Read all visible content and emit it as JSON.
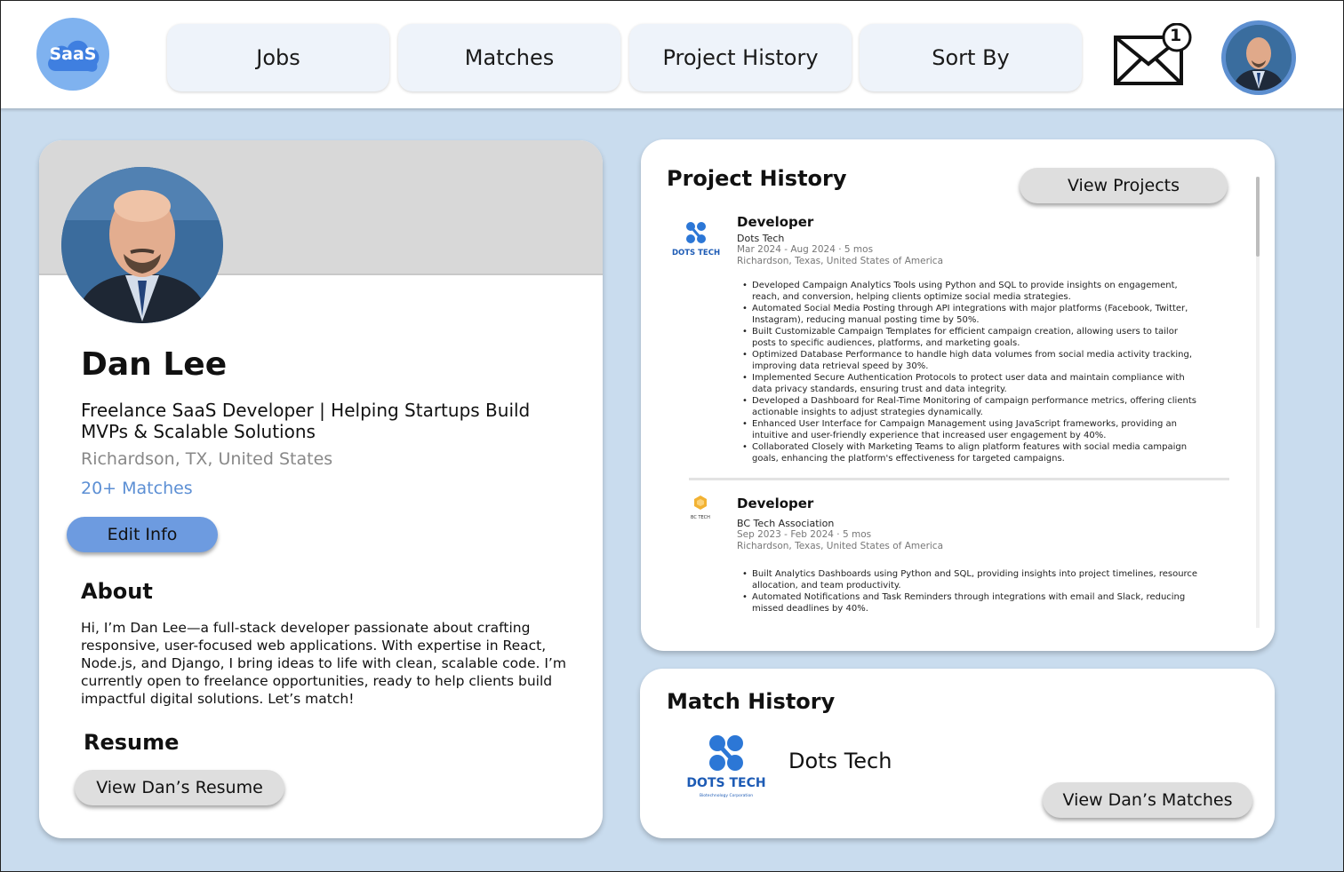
{
  "app": {
    "logo_text": "SaaS",
    "accent_color": "#6d9be0",
    "background_color": "#c9dcee"
  },
  "nav": {
    "items": [
      {
        "label": "Jobs"
      },
      {
        "label": "Matches"
      },
      {
        "label": "Project History"
      },
      {
        "label": "Sort By"
      }
    ],
    "mail_badge": "1"
  },
  "profile": {
    "name": "Dan Lee",
    "headline_line1": "Freelance SaaS Developer | Helping Startups Build",
    "headline_line2": "MVPs & Scalable Solutions",
    "location": "Richardson, TX, United States",
    "matches": "20+ Matches",
    "edit_label": "Edit Info",
    "about_title": "About",
    "about_text": "Hi, I’m Dan Lee—a full-stack developer passionate about crafting responsive, user-focused web applications. With expertise in React, Node.js, and Django, I bring ideas to life with clean, scalable code. I’m currently open to freelance opportunities, ready to help clients build impactful digital solutions. Let’s match!",
    "resume_title": "Resume",
    "resume_button": "View Dan’s Resume"
  },
  "projects": {
    "title": "Project History",
    "view_button": "View Projects",
    "entries": [
      {
        "role": "Developer",
        "company": "Dots Tech",
        "dates": "Mar 2024  -  Aug 2024 · 5 mos",
        "location": "Richardson, Texas, United States of America",
        "logo_text": "DOTS TECH",
        "bullets": [
          "Developed Campaign Analytics Tools using Python and SQL to provide insights on engagement, reach, and conversion, helping clients optimize social media strategies.",
          "Automated Social Media Posting through API integrations with major platforms (Facebook, Twitter, Instagram), reducing manual posting time by 50%.",
          "Built Customizable Campaign Templates for efficient campaign creation, allowing users to tailor posts to specific audiences, platforms, and marketing goals.",
          "Optimized Database Performance to handle high data volumes from social media activity tracking, improving data retrieval speed by 30%.",
          "Implemented Secure Authentication Protocols to protect user data and maintain compliance with data privacy standards, ensuring trust and data integrity.",
          "Developed a Dashboard for Real-Time Monitoring of campaign performance metrics, offering clients actionable insights to adjust strategies dynamically.",
          "Enhanced User Interface for Campaign Management using JavaScript frameworks, providing an intuitive and user-friendly experience that increased user engagement by 40%.",
          "Collaborated Closely with Marketing Teams to align platform features with social media campaign goals, enhancing the platform's effectiveness for targeted campaigns."
        ]
      },
      {
        "role": "Developer",
        "company": "BC Tech Association",
        "dates": "Sep 2023  -  Feb 2024 · 5 mos",
        "location": "Richardson, Texas, United States of America",
        "logo_text": "BC TECH",
        "bullets": [
          "Built Analytics Dashboards using Python and SQL, providing insights into project timelines, resource allocation, and team productivity.",
          "Automated Notifications and Task Reminders through integrations with email and Slack, reducing missed deadlines by 40%."
        ]
      }
    ]
  },
  "matches": {
    "title": "Match History",
    "company": "Dots Tech",
    "logo_text": "DOTS TECH",
    "logo_subtext": "Biotechnology Corporation",
    "view_button": "View Dan’s Matches"
  }
}
